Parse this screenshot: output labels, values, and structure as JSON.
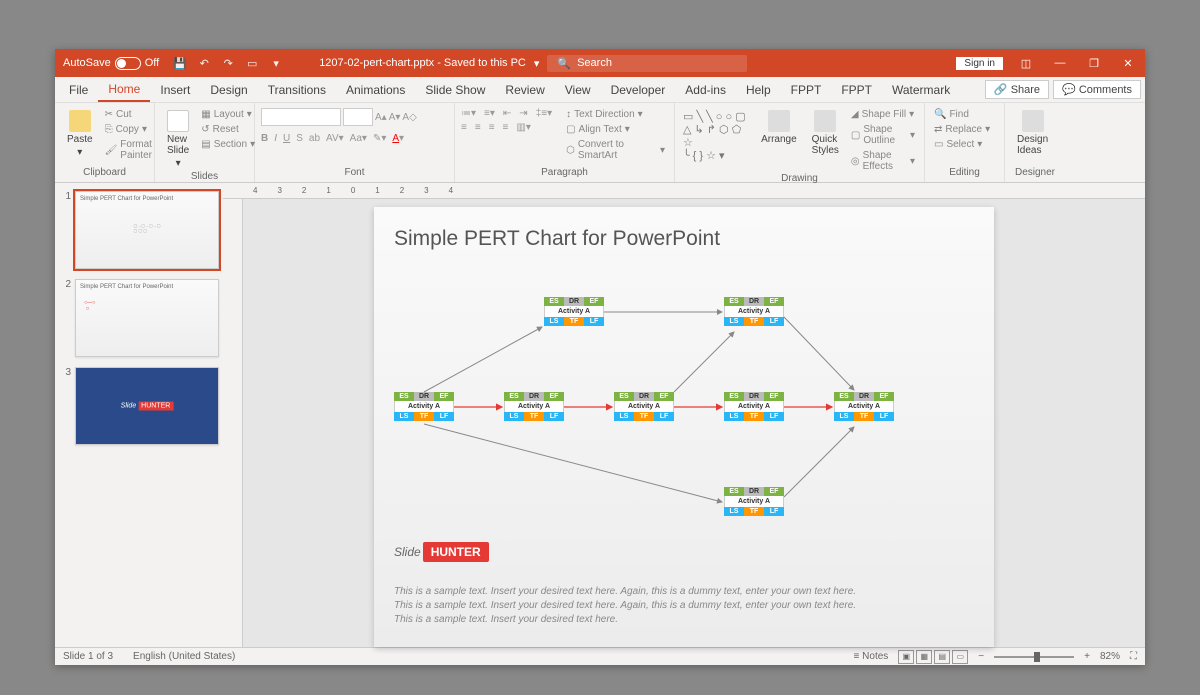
{
  "titlebar": {
    "autosave": "AutoSave",
    "autosave_state": "Off",
    "filename": "1207-02-pert-chart.pptx - Saved to this PC",
    "search_placeholder": "Search",
    "signin": "Sign in"
  },
  "tabs": {
    "file": "File",
    "home": "Home",
    "insert": "Insert",
    "design": "Design",
    "transitions": "Transitions",
    "animations": "Animations",
    "slideshow": "Slide Show",
    "review": "Review",
    "view": "View",
    "developer": "Developer",
    "addins": "Add-ins",
    "help": "Help",
    "fppt": "FPPT",
    "fppt2": "FPPT",
    "watermark": "Watermark"
  },
  "share": {
    "share": "Share",
    "comments": "Comments"
  },
  "ribbon": {
    "clipboard": {
      "label": "Clipboard",
      "paste": "Paste",
      "cut": "Cut",
      "copy": "Copy",
      "fmtpainter": "Format Painter"
    },
    "slides": {
      "label": "Slides",
      "newslide": "New\nSlide",
      "layout": "Layout",
      "reset": "Reset",
      "section": "Section"
    },
    "font": {
      "label": "Font"
    },
    "paragraph": {
      "label": "Paragraph",
      "textdir": "Text Direction",
      "align": "Align Text",
      "smartart": "Convert to SmartArt"
    },
    "drawing": {
      "label": "Drawing",
      "arrange": "Arrange",
      "quickstyles": "Quick\nStyles",
      "shapefill": "Shape Fill",
      "shapeoutline": "Shape Outline",
      "shapeeffects": "Shape Effects"
    },
    "editing": {
      "label": "Editing",
      "find": "Find",
      "replace": "Replace",
      "select": "Select"
    },
    "designer": {
      "label": "Designer",
      "ideas": "Design\nIdeas"
    }
  },
  "thumbnails": {
    "t1": "Simple PERT Chart for PowerPoint",
    "t2": "Simple PERT Chart for PowerPoint"
  },
  "slide": {
    "title": "Simple PERT Chart for PowerPoint",
    "node_labels": {
      "es": "ES",
      "dr": "DR",
      "ef": "EF",
      "activity": "Activity A",
      "ls": "LS",
      "tf": "TF",
      "lf": "LF"
    },
    "logo1": "Slide",
    "logo2": "HUNTER",
    "sample1": "This is a sample text. Insert your desired text here. Again, this is a dummy text, enter your own text here.",
    "sample2": "This is a sample text. Insert your desired text here. Again, this is a dummy text, enter your own text here.",
    "sample3": "This is a sample text. Insert your desired text here."
  },
  "statusbar": {
    "slidecount": "Slide 1 of 3",
    "lang": "English (United States)",
    "notes": "Notes",
    "zoom": "82%"
  }
}
